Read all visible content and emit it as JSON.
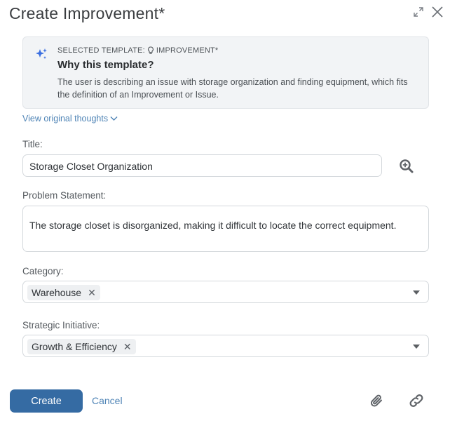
{
  "dialog": {
    "title": "Create Improvement*"
  },
  "why": {
    "label": "SELECTED TEMPLATE:",
    "template": "IMPROVEMENT*",
    "title": "Why this template?",
    "text": "The user is describing an issue with storage organization and finding equipment, which fits the definition of an Improvement or Issue."
  },
  "thoughts": {
    "label": "View original thoughts"
  },
  "fields": {
    "title": {
      "label": "Title:",
      "value": "Storage Closet Organization"
    },
    "problem": {
      "label": "Problem Statement:",
      "value": "The storage closet is disorganized, making it difficult to locate the correct equipment."
    },
    "category": {
      "label": "Category:",
      "chip": "Warehouse"
    },
    "initiative": {
      "label": "Strategic Initiative:",
      "chip": "Growth & Efficiency"
    }
  },
  "actions": {
    "create": "Create",
    "cancel": "Cancel"
  },
  "icons": {
    "expand": "expand-icon",
    "close": "close-icon",
    "sparkle": "sparkle-icon",
    "lightbulb": "lightbulb-icon",
    "zoom": "zoom-in-icon",
    "attach": "paperclip-icon",
    "link": "link-icon"
  },
  "colors": {
    "primary": "#356ba3",
    "link": "#4f84b6",
    "sparkle": "#3b6fe0"
  }
}
